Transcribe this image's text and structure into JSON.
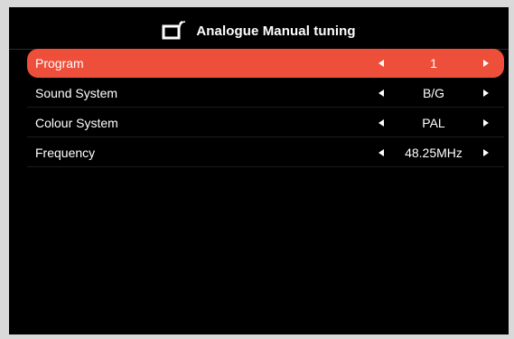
{
  "header": {
    "title": "Analogue Manual tuning",
    "icon": "tv-signal-icon"
  },
  "menu": {
    "items": [
      {
        "label": "Program",
        "value": "1",
        "selected": true
      },
      {
        "label": "Sound System",
        "value": "B/G",
        "selected": false
      },
      {
        "label": "Colour System",
        "value": "PAL",
        "selected": false
      },
      {
        "label": "Frequency",
        "value": "48.25MHz",
        "selected": false
      }
    ]
  },
  "colors": {
    "background": "#000000",
    "highlight": "#ee4f3a",
    "text": "#ffffff"
  }
}
